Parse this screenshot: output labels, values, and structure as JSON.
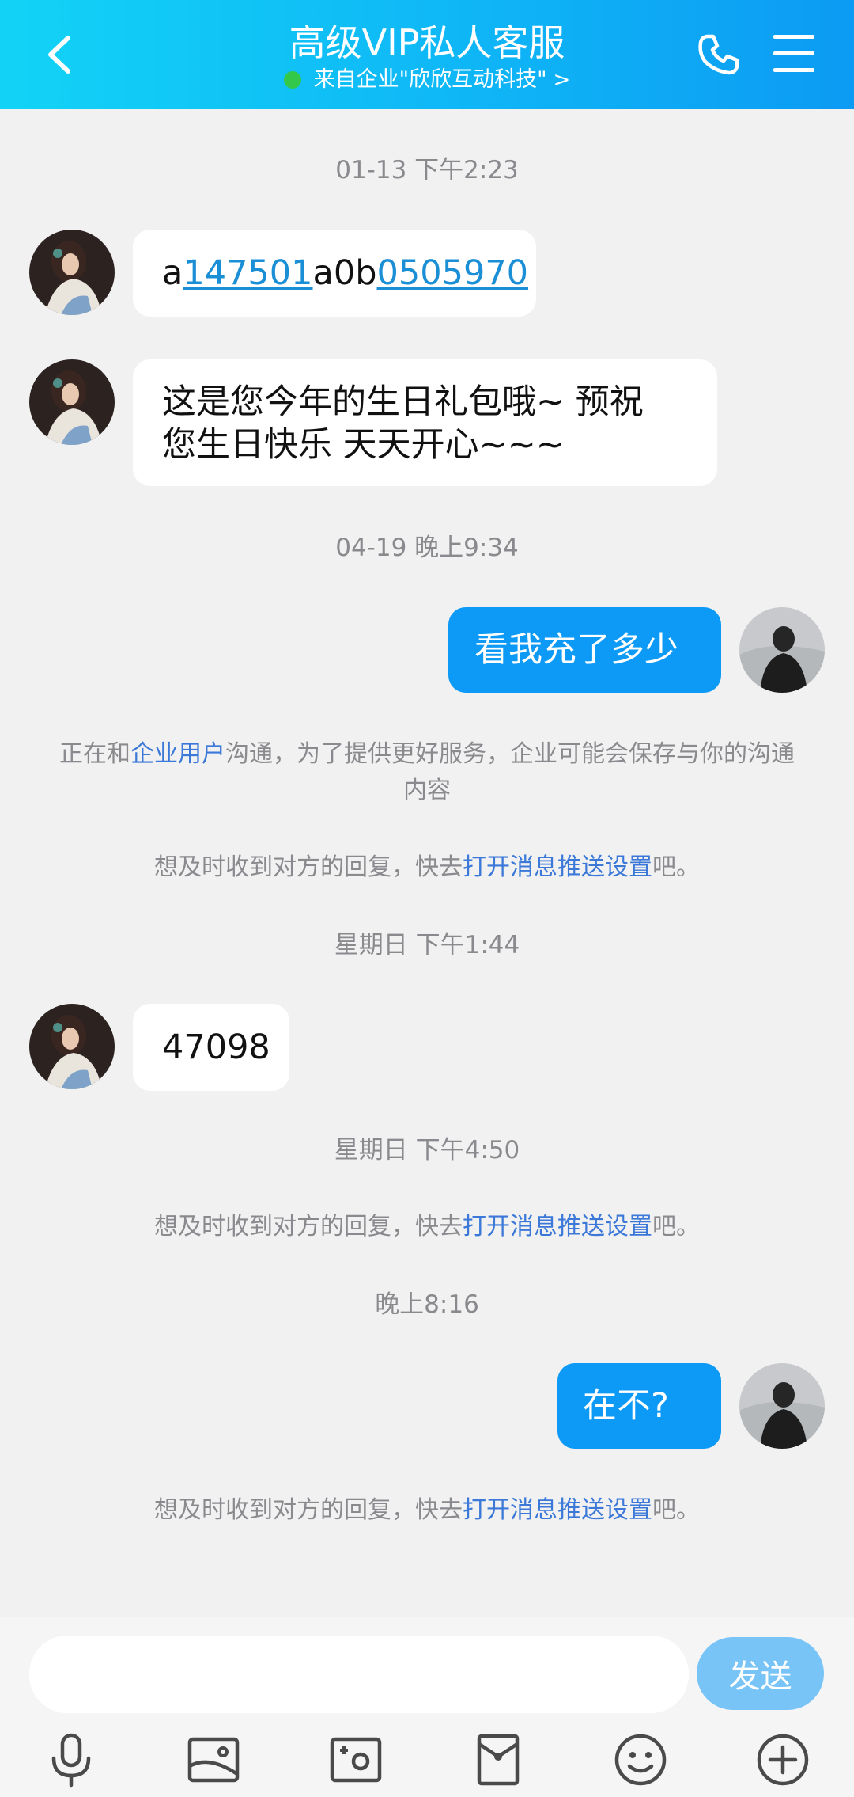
{
  "header": {
    "title": "高级VIP私人客服",
    "subtitle": "来自企业\"欣欣互动科技\"",
    "subtitle_chevron": ">"
  },
  "messages": {
    "t1": "01-13 下午2:23",
    "m1": {
      "prefix": "a",
      "link1": "147501",
      "mid": "a0b",
      "link2": "0505970"
    },
    "m2": {
      "line1": "这是您今年的生日礼包哦~ 预祝",
      "line2": "您生日快乐 天天开心~~~"
    },
    "t2": "04-19 晚上9:34",
    "m3": "看我充了多少",
    "sys1": {
      "pre": "正在和",
      "link": "企业用户",
      "post": "沟通，为了提供更好服务，企业可能会保存与你的沟通内容"
    },
    "sys2": {
      "pre": "想及时收到对方的回复，快去",
      "link": "打开消息推送设置",
      "post": "吧。"
    },
    "t3": "星期日 下午1:44",
    "m4": "47098",
    "t4": "星期日 下午4:50",
    "sys3": {
      "pre": "想及时收到对方的回复，快去",
      "link": "打开消息推送设置",
      "post": "吧。"
    },
    "t5": "晚上8:16",
    "m5": "在不?",
    "sys4": {
      "pre": "想及时收到对方的回复，快去",
      "link": "打开消息推送设置",
      "post": "吧。"
    }
  },
  "input": {
    "placeholder": "",
    "value": "",
    "send_label": "发送"
  },
  "toolbar": [
    "microphone-icon",
    "photo-icon",
    "camera-icon",
    "red-packet-icon",
    "emoji-icon",
    "plus-icon"
  ],
  "colors": {
    "header_gradient_start": "#12d3f6",
    "header_gradient_end": "#0c9bf3",
    "out_bubble": "#0d99f6",
    "link": "#3b78d8",
    "online": "#34c84a"
  }
}
